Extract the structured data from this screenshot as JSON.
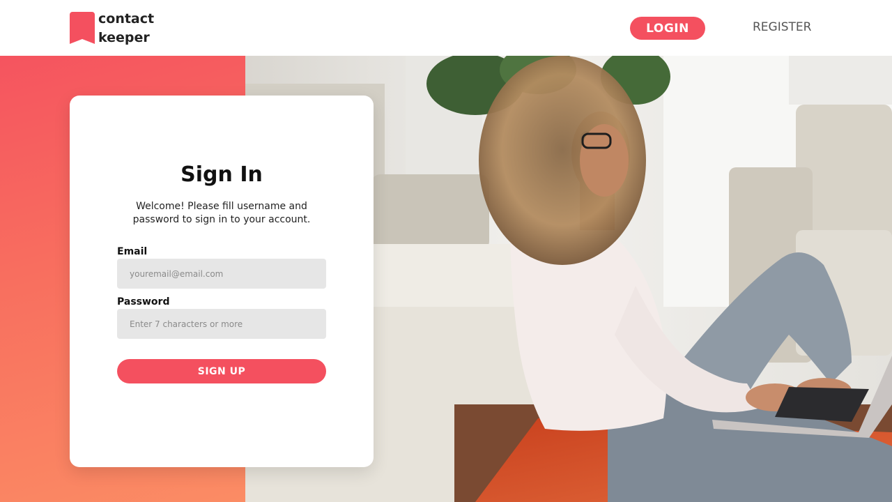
{
  "header": {
    "logo_line1": "contact",
    "logo_line2": "keeper",
    "login_label": "LOGIN",
    "register_label": "REGISTER"
  },
  "colors": {
    "accent": "#f4505f",
    "gradient_start": "#f5545f",
    "gradient_end": "#fb8c64",
    "input_bg": "#e6e6e6"
  },
  "signin": {
    "title": "Sign In",
    "subtitle": "Welcome! Please fill username and password to sign in to your account.",
    "email_label": "Email",
    "email_placeholder": "youremail@email.com",
    "email_value": "",
    "password_label": "Password",
    "password_placeholder": "Enter 7 characters or more",
    "password_value": "",
    "submit_label": "SIGN UP"
  },
  "hero": {
    "image_subject": "woman-sitting-on-floor-using-laptop"
  }
}
